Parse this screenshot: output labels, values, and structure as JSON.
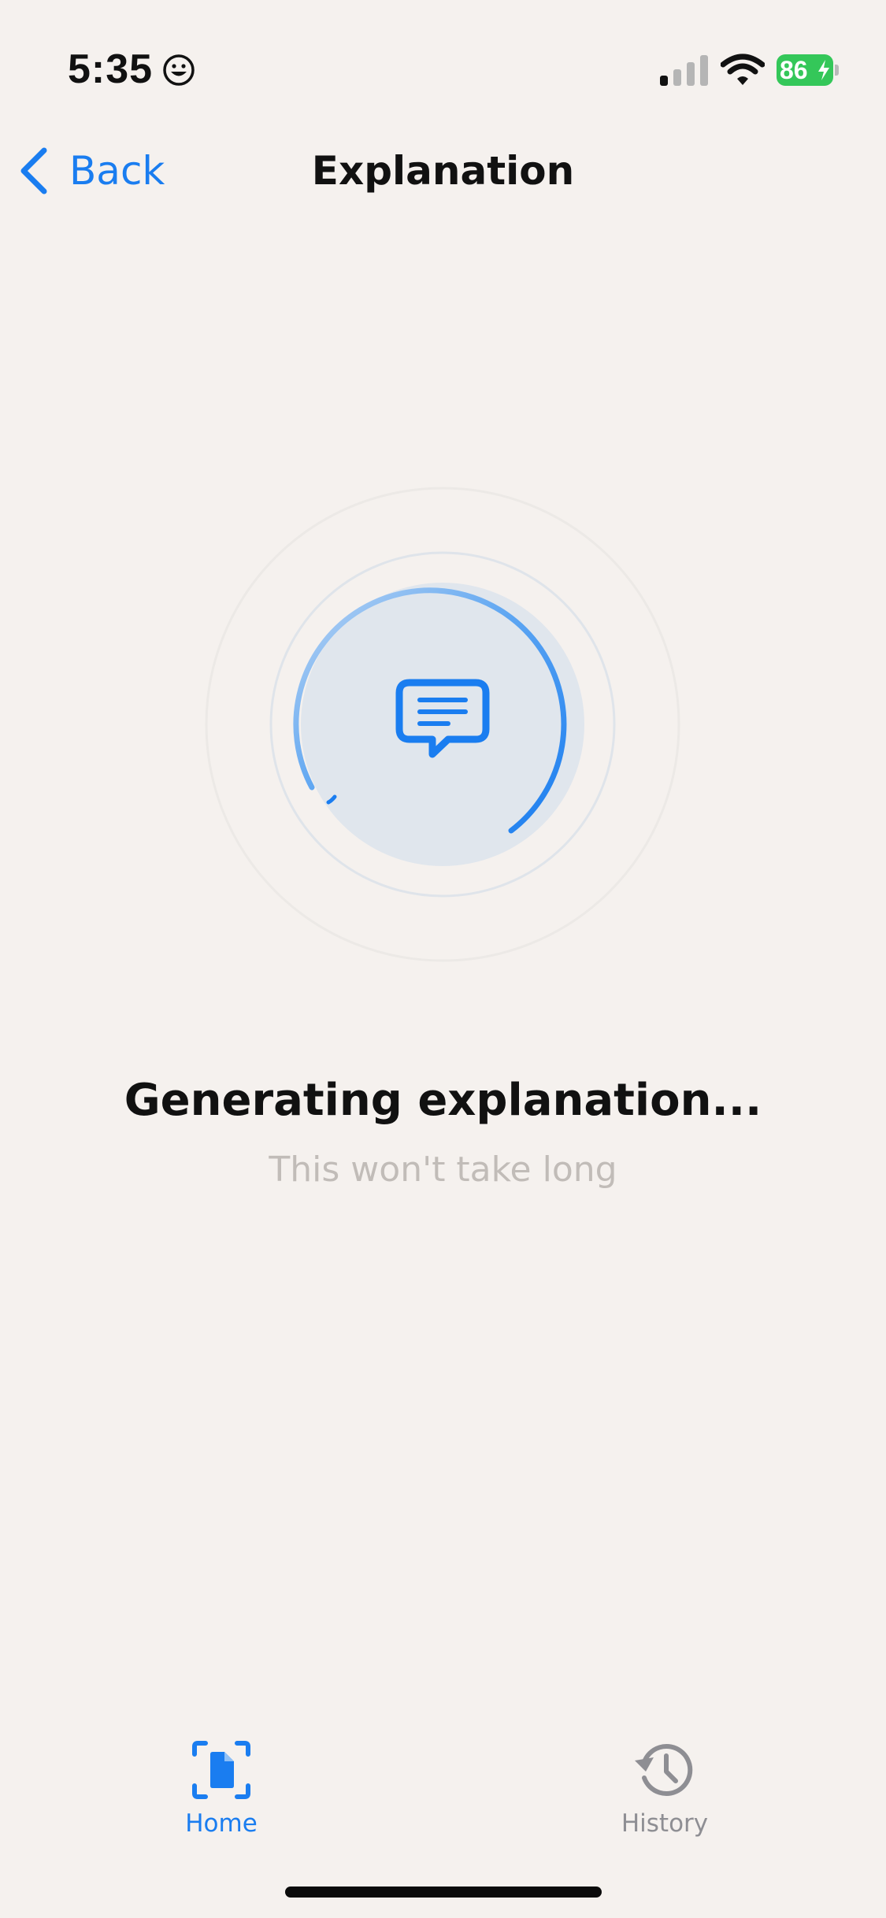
{
  "status_bar": {
    "time": "5:35",
    "battery": "86"
  },
  "nav": {
    "back_label": "Back",
    "title": "Explanation"
  },
  "loading": {
    "title": "Generating explanation...",
    "subtitle": "This won't take long"
  },
  "tabs": [
    {
      "label": "Home",
      "selected": true
    },
    {
      "label": "History",
      "selected": false
    }
  ],
  "colors": {
    "accent": "#1a7df0",
    "background": "#f5f1ee",
    "battery": "#34c759",
    "inactive": "#8e8e93"
  }
}
